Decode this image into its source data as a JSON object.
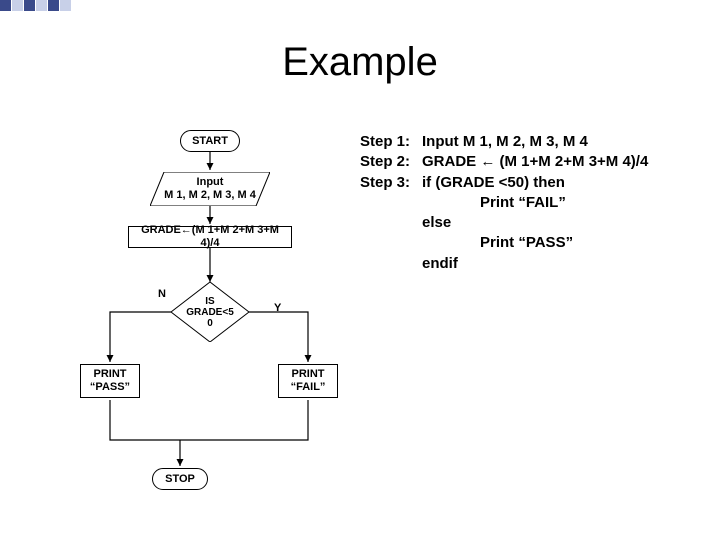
{
  "title": "Example",
  "flow": {
    "start": "START",
    "input": "Input\nM 1, M 2, M 3, M 4",
    "process": "GRADE←(M 1+M 2+M 3+M 4)/4",
    "decision": "IS\nGRADE<5\n0",
    "n": "N",
    "y": "Y",
    "print_pass": "PRINT\n“PASS”",
    "print_fail": "PRINT\n“FAIL”",
    "stop": "STOP"
  },
  "pseudo": {
    "step1_label": "Step 1:",
    "step1_text": "Input M 1, M 2, M 3, M 4",
    "step2_label": "Step 2:",
    "step2_text": "GRADE ← (M 1+M 2+M 3+M 4)/4",
    "step3_label": "Step 3:",
    "step3_text": "if (GRADE <50) then",
    "line4": "Print “FAIL”",
    "line5": "else",
    "line6": "Print “PASS”",
    "line7": "endif"
  }
}
